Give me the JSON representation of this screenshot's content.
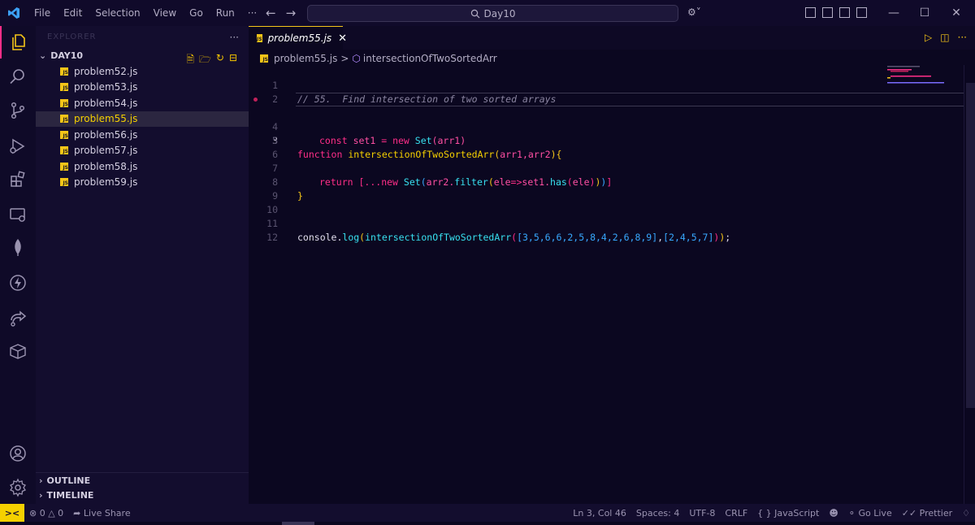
{
  "menu": {
    "items": [
      "File",
      "Edit",
      "Selection",
      "View",
      "Go",
      "Run",
      "···"
    ]
  },
  "command_center": {
    "text": "Day10"
  },
  "explorer": {
    "header": "EXPLORER",
    "more": "···",
    "folder": "DAY10",
    "files": [
      "problem52.js",
      "problem53.js",
      "problem54.js",
      "problem55.js",
      "problem56.js",
      "problem57.js",
      "problem58.js",
      "problem59.js"
    ],
    "active_file": "problem55.js",
    "outline": "OUTLINE",
    "timeline": "TIMELINE"
  },
  "tab": {
    "label": "problem55.js",
    "close": "✕"
  },
  "breadcrumb": {
    "file": "problem55.js",
    "separator": ">",
    "symbol": "intersectionOfTwoSortedArr"
  },
  "editor": {
    "line_numbers": [
      "1",
      "2",
      "3",
      "4",
      "5",
      "6",
      "7",
      "8",
      "9",
      "10",
      "11",
      "12"
    ],
    "current_line": "3",
    "line1": "// 55.  Find intersection of two sorted arrays",
    "line3": {
      "kw": "function",
      "name": "intersectionOfTwoSortedArr",
      "open": "(",
      "params": "arr1,arr2",
      "close": ")",
      "brace": "{"
    },
    "line4": {
      "kw": "const",
      "name": "set1",
      "op": "=",
      "new": "new",
      "cls": "Set",
      "args": "(arr1)"
    },
    "line7": {
      "kw": "return",
      "b1": "[",
      "spread": "...",
      "new": "new",
      "cls": "Set",
      "p1": "(",
      "arr": "arr2.",
      "filter": "filter",
      "p2": "(",
      "param": "ele",
      "arrow": "=>",
      "set": "set1.",
      "has": "has",
      "p3": "(",
      "arg": "ele",
      "close3": ")",
      "close2": ")",
      "close1": ")",
      "b2": "]"
    },
    "line8": "}",
    "line11": {
      "obj": "console.",
      "log": "log",
      "p1": "(",
      "fn": "intersectionOfTwoSortedArr",
      "p2": "(",
      "arr1": "[3,5,6,6,2,5,8,4,2,6,8,9]",
      "comma": ",",
      "arr2": "[2,4,5,7]",
      "close2": ")",
      "close1": ")",
      "semi": ";"
    }
  },
  "statusbar": {
    "errors": "0",
    "warnings": "0",
    "live_share": "Live Share",
    "cursor": "Ln 3, Col 46",
    "spaces": "Spaces: 4",
    "encoding": "UTF-8",
    "eol": "CRLF",
    "language": "JavaScript",
    "go_live": "Go Live",
    "prettier": "Prettier"
  },
  "colors": {
    "accent_yellow": "#f5c518",
    "accent_pink": "#ff2e88",
    "background": "#0b0720"
  }
}
